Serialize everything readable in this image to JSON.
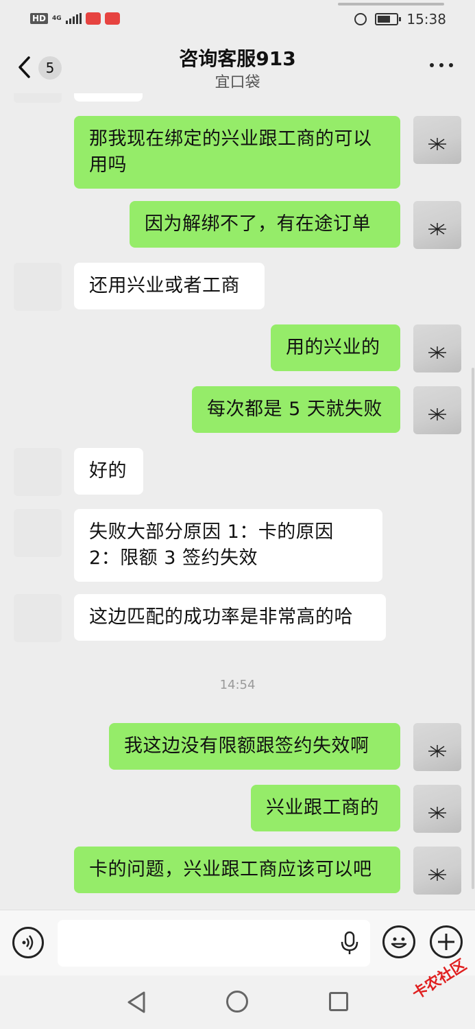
{
  "status_bar": {
    "hd": "HD",
    "network": "4G",
    "time": "15:38"
  },
  "header": {
    "unread_count": "5",
    "title": "咨询客服913",
    "subtitle": "宜口袋"
  },
  "messages": [
    {
      "side": "out",
      "text": "那我现在绑定的兴业跟工商的可以用吗"
    },
    {
      "side": "out",
      "text": "因为解绑不了，有在途订单"
    },
    {
      "side": "in",
      "text": "还用兴业或者工商"
    },
    {
      "side": "out",
      "text": "用的兴业的"
    },
    {
      "side": "out",
      "text": "每次都是 5 天就失败"
    },
    {
      "side": "in",
      "text": "好的"
    },
    {
      "side": "in",
      "text": "失败大部分原因 1：卡的原因 2：限额 3 签约失效"
    },
    {
      "side": "in",
      "text": "这边匹配的成功率是非常高的哈"
    },
    {
      "side": "time",
      "text": "14:54"
    },
    {
      "side": "out",
      "text": "我这边没有限额跟签约失效啊"
    },
    {
      "side": "out",
      "text": "兴业跟工商的"
    },
    {
      "side": "out",
      "text": "卡的问题，兴业跟工商应该可以吧"
    }
  ],
  "input": {
    "value": ""
  },
  "watermark": "卡农社区",
  "colors": {
    "outgoing_bubble": "#95ec69",
    "incoming_bubble": "#ffffff",
    "background": "#ededed"
  },
  "icons": {
    "back": "chevron-left-icon",
    "more": "more-dots-icon",
    "voice": "voice-icon",
    "mic": "mic-icon",
    "emoji": "emoji-icon",
    "plus": "plus-icon"
  }
}
